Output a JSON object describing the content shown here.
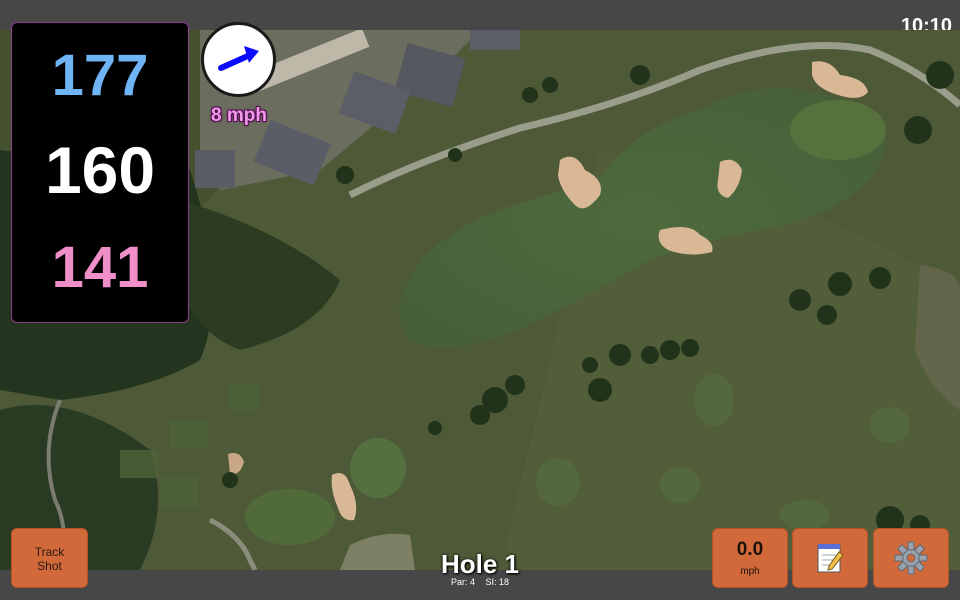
{
  "status_bar": {
    "time": "10:10"
  },
  "distances": {
    "back": "177",
    "center": "160",
    "front": "141"
  },
  "wind": {
    "speed": "8 mph",
    "direction_icon": "arrow-icon"
  },
  "buttons": {
    "track_shot_line1": "Track",
    "track_shot_line2": "Shot",
    "speed_value": "0.0",
    "speed_unit": "mph",
    "notes_icon": "notepad-icon",
    "settings_icon": "gear-icon"
  },
  "hole": {
    "title": "Hole 1",
    "par": "Par: 4",
    "si": "SI: 18"
  },
  "colors": {
    "back_distance": "#6fb4f5",
    "center_distance": "#ffffff",
    "front_distance": "#f08ec8",
    "wind_text": "#f09be8",
    "button_orange": "#d2693a",
    "panel_border": "#8e3a8e"
  }
}
